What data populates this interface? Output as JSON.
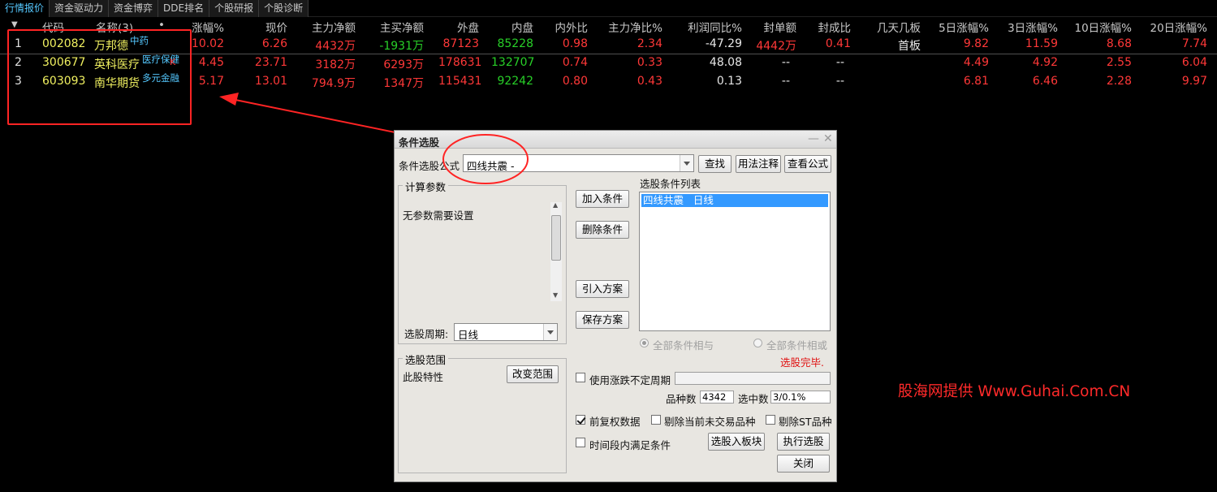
{
  "tabs": [
    "行情报价",
    "资金驱动力",
    "资金博弈",
    "DDE排名",
    "个股研报",
    "个股诊断"
  ],
  "header": {
    "sort_marker": "▼",
    "code": "代码",
    "name": "名称(3)",
    "dot": "•",
    "pct": "涨幅%",
    "price": "现价",
    "main_net": "主力净额",
    "main_buy_net": "主买净额",
    "outer": "外盘",
    "inner": "内盘",
    "ratio": "内外比",
    "main_net_pct": "主力净比%",
    "profit_yoy": "利润同比%",
    "seal_amt": "封单额",
    "seal_ratio": "封成比",
    "boards": "几天几板",
    "d5": "5日涨幅%",
    "d3": "3日涨幅%",
    "d10": "10日涨幅%",
    "d20": "20日涨幅%"
  },
  "rows": [
    {
      "seq": "1",
      "code": "002082",
      "name": "万邦德",
      "tag1": "中药",
      "tag2": "",
      "pct": "10.02",
      "price": "6.26",
      "main_net": "4432万",
      "main_buy_net": "-1931万",
      "outer": "87123",
      "inner": "85228",
      "ratio": "0.98",
      "main_net_pct": "2.34",
      "profit_yoy": "-47.29",
      "seal_amt": "4442万",
      "seal_ratio": "0.41",
      "boards": "首板",
      "d5": "9.82",
      "d3": "11.59",
      "d10": "8.68",
      "d20": "7.74"
    },
    {
      "seq": "2",
      "code": "300677",
      "name": "英科医疗",
      "tag1": "医疗保健",
      "tag2": "K",
      "pct": "4.45",
      "price": "23.71",
      "main_net": "3182万",
      "main_buy_net": "6293万",
      "outer": "178631",
      "inner": "132707",
      "ratio": "0.74",
      "main_net_pct": "0.33",
      "profit_yoy": "48.08",
      "seal_amt": "--",
      "seal_ratio": "--",
      "boards": "",
      "d5": "4.49",
      "d3": "4.92",
      "d10": "2.55",
      "d20": "6.04"
    },
    {
      "seq": "3",
      "code": "603093",
      "name": "南华期货",
      "tag1": "多元金融",
      "tag2": "",
      "pct": "5.17",
      "price": "13.01",
      "main_net": "794.9万",
      "main_buy_net": "1347万",
      "outer": "115431",
      "inner": "92242",
      "ratio": "0.80",
      "main_net_pct": "0.43",
      "profit_yoy": "0.13",
      "seal_amt": "--",
      "seal_ratio": "--",
      "boards": "",
      "d5": "6.81",
      "d3": "6.46",
      "d10": "2.28",
      "d20": "9.97"
    }
  ],
  "dialog": {
    "title": "条件选股",
    "formula_label": "条件选股公式",
    "formula_value": "四线共震  -",
    "find": "查找",
    "usage": "用法注释",
    "view": "查看公式",
    "params_group": "计算参数",
    "no_params": "无参数需要设置",
    "period_label": "选股周期:",
    "period_value": "日线",
    "add": "加入条件",
    "delete": "删除条件",
    "import": "引入方案",
    "save": "保存方案",
    "list_title": "选股条件列表",
    "list_item": "四线共震   日线",
    "radio_and": "全部条件相与",
    "radio_or": "全部条件相或",
    "status": "选股完毕.",
    "range_group": "选股范围",
    "range_text": "此股特性",
    "change_range": "改变范围",
    "use_period": "使用涨跌不定周期",
    "count_label": "品种数",
    "count_value": "4342",
    "selected_label": "选中数",
    "selected_value": "3/0.1%",
    "pre_adjust": "前复权数据",
    "exclude_untraded": "剔除当前未交易品种",
    "exclude_st": "剔除ST品种",
    "time_cond": "时间段内满足条件",
    "to_board": "选股入板块",
    "execute": "执行选股",
    "close": "关闭"
  },
  "watermark": "股海网提供 Www.Guhai.Com.CN"
}
